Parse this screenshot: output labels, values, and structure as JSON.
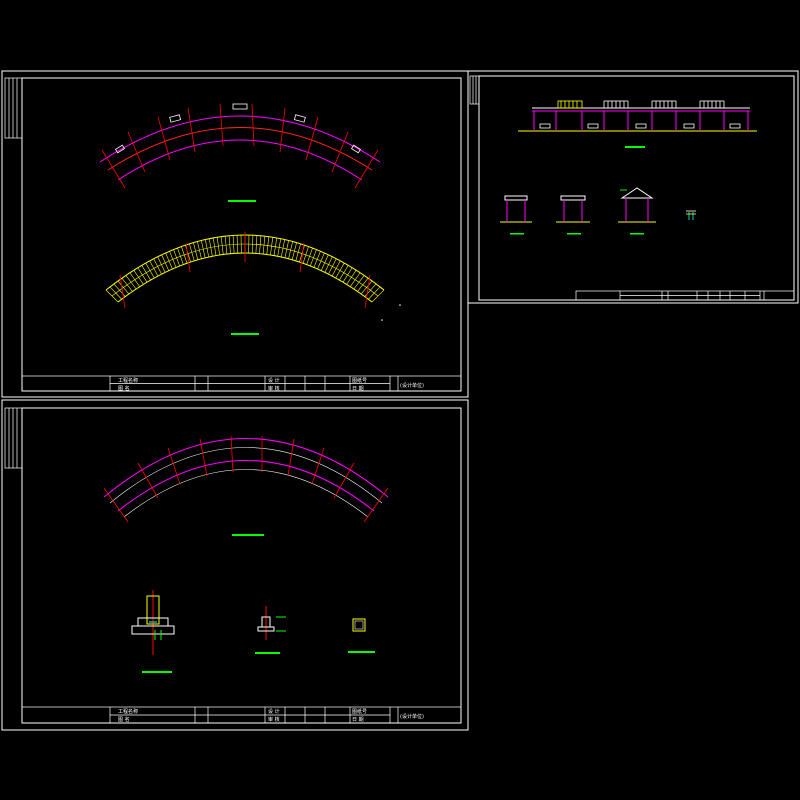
{
  "colors": {
    "background": "#000000",
    "frame": "#ffffff",
    "pergola_outline": "#ff00ff",
    "axis": "#ff0000",
    "timber": "#ffff00",
    "label_bar": "#00ff00",
    "accent_cyan": "#00ffff"
  },
  "sheets": [
    {
      "name": "sheet-plan-top",
      "label": "pergola-plan-sheet"
    },
    {
      "name": "sheet-elevation",
      "label": "pergola-elevation-sheet"
    },
    {
      "name": "sheet-foundation",
      "label": "pergola-foundation-sheet"
    }
  ],
  "title_block": {
    "project_label": "工程名称",
    "drawing_label": "图 名",
    "design_label": "设 计",
    "check_label": "审 核",
    "drawing_no_label": "图纸号",
    "date_label": "日 期",
    "company_label": "(设计单位)"
  },
  "icons": [
    "column-icon",
    "beam-icon",
    "axis-line-icon"
  ]
}
